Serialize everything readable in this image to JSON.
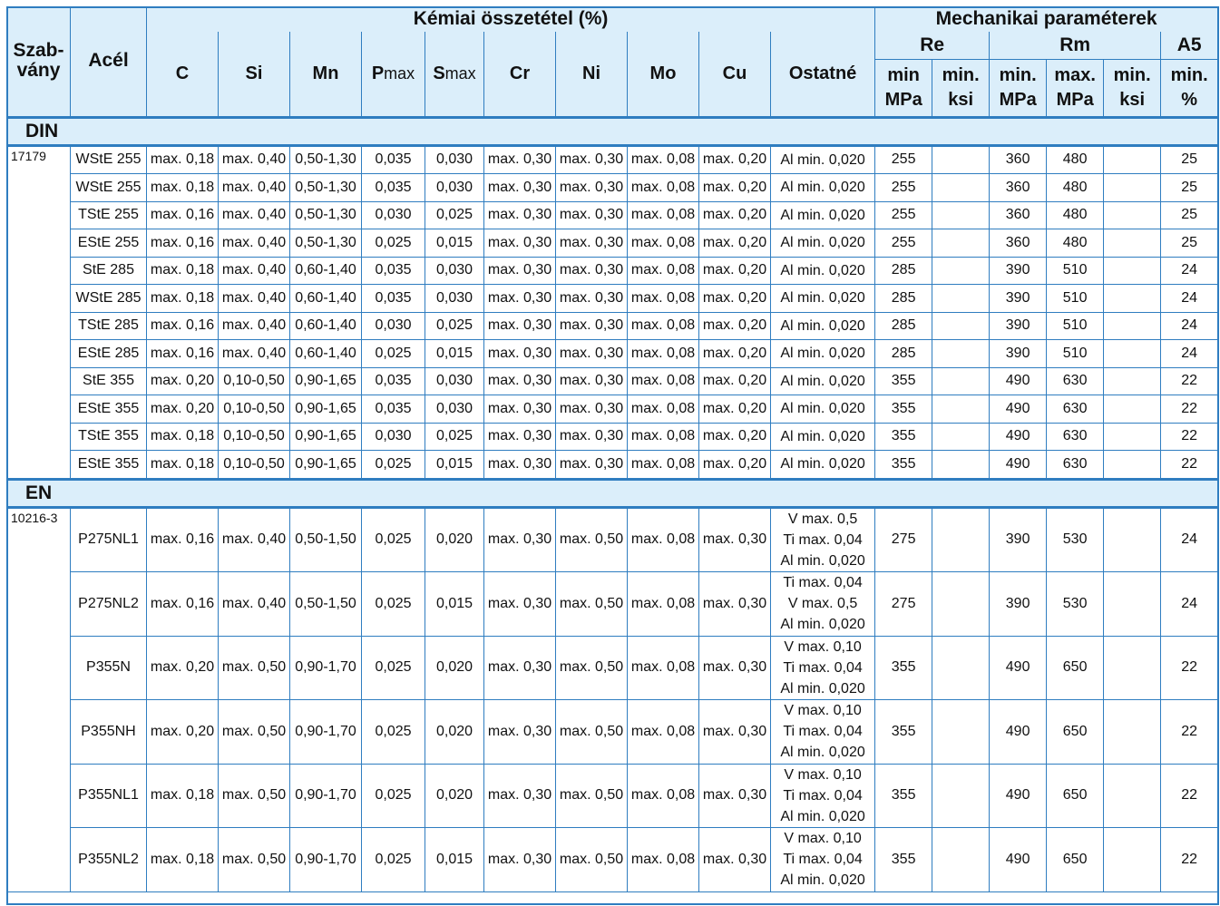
{
  "header": {
    "standard": "Szab-\nvány",
    "steel": "Acél",
    "chemical_group": "Kémiai összetétel (%)",
    "mechanical_group": "Mechanikai paraméterek",
    "re_group": "Re",
    "rm_group": "Rm",
    "a5_group": "A5",
    "elements": [
      {
        "main": "C",
        "sub": ""
      },
      {
        "main": "Si",
        "sub": ""
      },
      {
        "main": "Mn",
        "sub": ""
      },
      {
        "main": "P",
        "sub": "max"
      },
      {
        "main": "S",
        "sub": "max"
      },
      {
        "main": "Cr",
        "sub": ""
      },
      {
        "main": "Ni",
        "sub": ""
      },
      {
        "main": "Mo",
        "sub": ""
      },
      {
        "main": "Cu",
        "sub": ""
      },
      {
        "main": "Ostatné",
        "sub": ""
      }
    ],
    "mech_cols": [
      {
        "top": "min",
        "bottom": "MPa"
      },
      {
        "top": "min.",
        "bottom": "ksi"
      },
      {
        "top": "min.",
        "bottom": "MPa"
      },
      {
        "top": "max.",
        "bottom": "MPa"
      },
      {
        "top": "min.",
        "bottom": "ksi"
      },
      {
        "top": "min.",
        "bottom": "%"
      }
    ]
  },
  "sections": [
    {
      "name": "DIN",
      "standard": "17179",
      "rows": [
        {
          "steel": "WStE 255",
          "c": "max. 0,18",
          "si": "max. 0,40",
          "mn": "0,50-1,30",
          "p": "0,035",
          "s": "0,030",
          "cr": "max. 0,30",
          "ni": "max. 0,30",
          "mo": "max. 0,08",
          "cu": "max. 0,20",
          "other": [
            "Al min. 0,020"
          ],
          "re_mpa": "255",
          "re_ksi": "",
          "rm_min": "360",
          "rm_max": "480",
          "rm_ksi": "",
          "a5": "25"
        },
        {
          "steel": "WStE 255",
          "c": "max. 0,18",
          "si": "max. 0,40",
          "mn": "0,50-1,30",
          "p": "0,035",
          "s": "0,030",
          "cr": "max. 0,30",
          "ni": "max. 0,30",
          "mo": "max. 0,08",
          "cu": "max. 0,20",
          "other": [
            "Al min. 0,020"
          ],
          "re_mpa": "255",
          "re_ksi": "",
          "rm_min": "360",
          "rm_max": "480",
          "rm_ksi": "",
          "a5": "25"
        },
        {
          "steel": "TStE 255",
          "c": "max. 0,16",
          "si": "max. 0,40",
          "mn": "0,50-1,30",
          "p": "0,030",
          "s": "0,025",
          "cr": "max. 0,30",
          "ni": "max. 0,30",
          "mo": "max. 0,08",
          "cu": "max. 0,20",
          "other": [
            "Al min. 0,020"
          ],
          "re_mpa": "255",
          "re_ksi": "",
          "rm_min": "360",
          "rm_max": "480",
          "rm_ksi": "",
          "a5": "25"
        },
        {
          "steel": "EStE 255",
          "c": "max. 0,16",
          "si": "max. 0,40",
          "mn": "0,50-1,30",
          "p": "0,025",
          "s": "0,015",
          "cr": "max. 0,30",
          "ni": "max. 0,30",
          "mo": "max. 0,08",
          "cu": "max. 0,20",
          "other": [
            "Al min. 0,020"
          ],
          "re_mpa": "255",
          "re_ksi": "",
          "rm_min": "360",
          "rm_max": "480",
          "rm_ksi": "",
          "a5": "25"
        },
        {
          "steel": "StE 285",
          "c": "max. 0,18",
          "si": "max. 0,40",
          "mn": "0,60-1,40",
          "p": "0,035",
          "s": "0,030",
          "cr": "max. 0,30",
          "ni": "max. 0,30",
          "mo": "max. 0,08",
          "cu": "max. 0,20",
          "other": [
            "Al min. 0,020"
          ],
          "re_mpa": "285",
          "re_ksi": "",
          "rm_min": "390",
          "rm_max": "510",
          "rm_ksi": "",
          "a5": "24"
        },
        {
          "steel": "WStE 285",
          "c": "max. 0,18",
          "si": "max. 0,40",
          "mn": "0,60-1,40",
          "p": "0,035",
          "s": "0,030",
          "cr": "max. 0,30",
          "ni": "max. 0,30",
          "mo": "max. 0,08",
          "cu": "max. 0,20",
          "other": [
            "Al min. 0,020"
          ],
          "re_mpa": "285",
          "re_ksi": "",
          "rm_min": "390",
          "rm_max": "510",
          "rm_ksi": "",
          "a5": "24"
        },
        {
          "steel": "TStE 285",
          "c": "max. 0,16",
          "si": "max. 0,40",
          "mn": "0,60-1,40",
          "p": "0,030",
          "s": "0,025",
          "cr": "max. 0,30",
          "ni": "max. 0,30",
          "mo": "max. 0,08",
          "cu": "max. 0,20",
          "other": [
            "Al min. 0,020"
          ],
          "re_mpa": "285",
          "re_ksi": "",
          "rm_min": "390",
          "rm_max": "510",
          "rm_ksi": "",
          "a5": "24"
        },
        {
          "steel": "EStE 285",
          "c": "max. 0,16",
          "si": "max. 0,40",
          "mn": "0,60-1,40",
          "p": "0,025",
          "s": "0,015",
          "cr": "max. 0,30",
          "ni": "max. 0,30",
          "mo": "max. 0,08",
          "cu": "max. 0,20",
          "other": [
            "Al min. 0,020"
          ],
          "re_mpa": "285",
          "re_ksi": "",
          "rm_min": "390",
          "rm_max": "510",
          "rm_ksi": "",
          "a5": "24"
        },
        {
          "steel": "StE 355",
          "c": "max. 0,20",
          "si": "0,10-0,50",
          "mn": "0,90-1,65",
          "p": "0,035",
          "s": "0,030",
          "cr": "max. 0,30",
          "ni": "max. 0,30",
          "mo": "max. 0,08",
          "cu": "max. 0,20",
          "other": [
            "Al min. 0,020"
          ],
          "re_mpa": "355",
          "re_ksi": "",
          "rm_min": "490",
          "rm_max": "630",
          "rm_ksi": "",
          "a5": "22"
        },
        {
          "steel": "EStE 355",
          "c": "max. 0,20",
          "si": "0,10-0,50",
          "mn": "0,90-1,65",
          "p": "0,035",
          "s": "0,030",
          "cr": "max. 0,30",
          "ni": "max. 0,30",
          "mo": "max. 0,08",
          "cu": "max. 0,20",
          "other": [
            "Al min. 0,020"
          ],
          "re_mpa": "355",
          "re_ksi": "",
          "rm_min": "490",
          "rm_max": "630",
          "rm_ksi": "",
          "a5": "22"
        },
        {
          "steel": "TStE 355",
          "c": "max. 0,18",
          "si": "0,10-0,50",
          "mn": "0,90-1,65",
          "p": "0,030",
          "s": "0,025",
          "cr": "max. 0,30",
          "ni": "max. 0,30",
          "mo": "max. 0,08",
          "cu": "max. 0,20",
          "other": [
            "Al min. 0,020"
          ],
          "re_mpa": "355",
          "re_ksi": "",
          "rm_min": "490",
          "rm_max": "630",
          "rm_ksi": "",
          "a5": "22"
        },
        {
          "steel": "EStE 355",
          "c": "max. 0,18",
          "si": "0,10-0,50",
          "mn": "0,90-1,65",
          "p": "0,025",
          "s": "0,015",
          "cr": "max. 0,30",
          "ni": "max. 0,30",
          "mo": "max. 0,08",
          "cu": "max. 0,20",
          "other": [
            "Al min. 0,020"
          ],
          "re_mpa": "355",
          "re_ksi": "",
          "rm_min": "490",
          "rm_max": "630",
          "rm_ksi": "",
          "a5": "22"
        }
      ]
    },
    {
      "name": "EN",
      "standard": "10216-3",
      "rows": [
        {
          "steel": "P275NL1",
          "c": "max. 0,16",
          "si": "max. 0,40",
          "mn": "0,50-1,50",
          "p": "0,025",
          "s": "0,020",
          "cr": "max. 0,30",
          "ni": "max. 0,50",
          "mo": "max. 0,08",
          "cu": "max. 0,30",
          "other": [
            "V max. 0,5",
            "Ti max. 0,04",
            "Al min. 0,020"
          ],
          "re_mpa": "275",
          "re_ksi": "",
          "rm_min": "390",
          "rm_max": "530",
          "rm_ksi": "",
          "a5": "24"
        },
        {
          "steel": "P275NL2",
          "c": "max. 0,16",
          "si": "max. 0,40",
          "mn": "0,50-1,50",
          "p": "0,025",
          "s": "0,015",
          "cr": "max. 0,30",
          "ni": "max. 0,50",
          "mo": "max. 0,08",
          "cu": "max. 0,30",
          "other": [
            "Ti max. 0,04",
            "V max. 0,5",
            "Al min. 0,020"
          ],
          "re_mpa": "275",
          "re_ksi": "",
          "rm_min": "390",
          "rm_max": "530",
          "rm_ksi": "",
          "a5": "24"
        },
        {
          "steel": "P355N",
          "c": "max. 0,20",
          "si": "max. 0,50",
          "mn": "0,90-1,70",
          "p": "0,025",
          "s": "0,020",
          "cr": "max. 0,30",
          "ni": "max. 0,50",
          "mo": "max. 0,08",
          "cu": "max. 0,30",
          "other": [
            "V max. 0,10",
            "Ti max. 0,04",
            "Al min. 0,020"
          ],
          "re_mpa": "355",
          "re_ksi": "",
          "rm_min": "490",
          "rm_max": "650",
          "rm_ksi": "",
          "a5": "22"
        },
        {
          "steel": "P355NH",
          "c": "max. 0,20",
          "si": "max. 0,50",
          "mn": "0,90-1,70",
          "p": "0,025",
          "s": "0,020",
          "cr": "max. 0,30",
          "ni": "max. 0,50",
          "mo": "max. 0,08",
          "cu": "max. 0,30",
          "other": [
            "V max. 0,10",
            "Ti max. 0,04",
            "Al min. 0,020"
          ],
          "re_mpa": "355",
          "re_ksi": "",
          "rm_min": "490",
          "rm_max": "650",
          "rm_ksi": "",
          "a5": "22"
        },
        {
          "steel": "P355NL1",
          "c": "max. 0,18",
          "si": "max. 0,50",
          "mn": "0,90-1,70",
          "p": "0,025",
          "s": "0,020",
          "cr": "max. 0,30",
          "ni": "max. 0,50",
          "mo": "max. 0,08",
          "cu": "max. 0,30",
          "other": [
            "V max. 0,10",
            "Ti max. 0,04",
            "Al min. 0,020"
          ],
          "re_mpa": "355",
          "re_ksi": "",
          "rm_min": "490",
          "rm_max": "650",
          "rm_ksi": "",
          "a5": "22"
        },
        {
          "steel": "P355NL2",
          "c": "max. 0,18",
          "si": "max. 0,50",
          "mn": "0,90-1,70",
          "p": "0,025",
          "s": "0,015",
          "cr": "max. 0,30",
          "ni": "max. 0,50",
          "mo": "max. 0,08",
          "cu": "max. 0,30",
          "other": [
            "V max. 0,10",
            "Ti max. 0,04",
            "Al min. 0,020"
          ],
          "re_mpa": "355",
          "re_ksi": "",
          "rm_min": "490",
          "rm_max": "650",
          "rm_ksi": "",
          "a5": "22"
        }
      ]
    }
  ]
}
